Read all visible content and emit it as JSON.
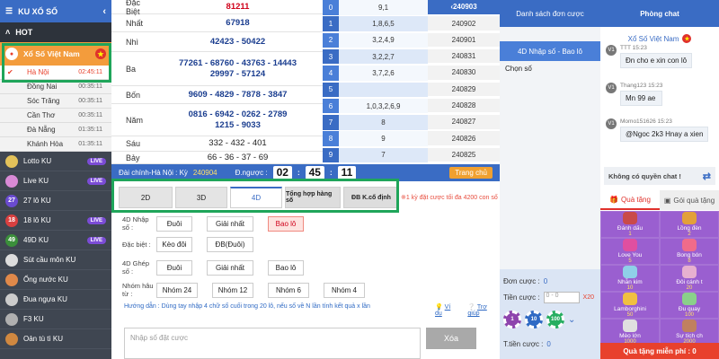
{
  "sidebar": {
    "header": "KU XỔ SỐ",
    "hot": "HOT",
    "xsvn": "Xổ Số Việt Nam",
    "regions": [
      {
        "name": "Hà Nội",
        "time": "02:45:11",
        "selected": true
      },
      {
        "name": "Đồng Nai",
        "time": "00:35:11"
      },
      {
        "name": "Sóc Trăng",
        "time": "00:35:11"
      },
      {
        "name": "Cần Thơ",
        "time": "00:35:11"
      },
      {
        "name": "Đà Nẵng",
        "time": "01:35:11"
      },
      {
        "name": "Khánh Hòa",
        "time": "01:35:11"
      }
    ],
    "games": [
      {
        "label": "Lotto KU",
        "live": "LIVE",
        "icon": "lotto-icon"
      },
      {
        "label": "Live KU",
        "live": "LIVE",
        "icon": "live-dealer-icon"
      },
      {
        "label": "27 lô KU",
        "badge": "27"
      },
      {
        "label": "18 lô KU",
        "live": "LIVE",
        "badge": "18"
      },
      {
        "label": "49D KU",
        "live": "LIVE",
        "badge": "49"
      },
      {
        "label": "Sút cầu môn KU",
        "icon": "soccer-ball-icon"
      },
      {
        "label": "Ống nước KU",
        "icon": "ladder-icon"
      },
      {
        "label": "Đua ngựa KU",
        "icon": "horse-icon"
      },
      {
        "label": "F3 KU",
        "icon": "car-icon"
      },
      {
        "label": "Oản tù tì KU",
        "icon": "hand-icon"
      }
    ]
  },
  "results": {
    "prizes": [
      {
        "name": "Đặc Biệt",
        "nums": "81211",
        "style": "red"
      },
      {
        "name": "Nhất",
        "nums": "67918",
        "style": "blue"
      },
      {
        "name": "Nhì",
        "nums": "42423 - 50422",
        "style": "blue"
      },
      {
        "name": "Ba",
        "nums": "77261 - 68760 - 43763 - 14443\n29997 - 57124",
        "style": "blue"
      },
      {
        "name": "Bốn",
        "nums": "9609 - 4829 - 7878 - 3847",
        "style": "blue"
      },
      {
        "name": "Năm",
        "nums": "0816 - 6942 - 0262 - 2789\n1215 - 9033",
        "style": "blue"
      },
      {
        "name": "Sáu",
        "nums": "332 - 432 - 401",
        "style": ""
      },
      {
        "name": "Bảy",
        "nums": "66 - 36 - 37 - 69",
        "style": ""
      }
    ],
    "digits": [
      {
        "k": "0",
        "v": "9,1"
      },
      {
        "k": "1",
        "v": "1,8,6,5"
      },
      {
        "k": "2",
        "v": "3,2,4,9"
      },
      {
        "k": "3",
        "v": "3,2,2,7"
      },
      {
        "k": "4",
        "v": "3,7,2,6"
      },
      {
        "k": "5",
        "v": ""
      },
      {
        "k": "6",
        "v": "1,0,3,2,6,9"
      },
      {
        "k": "7",
        "v": "8"
      },
      {
        "k": "8",
        "v": "9"
      },
      {
        "k": "9",
        "v": "7"
      }
    ],
    "kys": [
      "240903",
      "240902",
      "240901",
      "240831",
      "240830",
      "240829",
      "240828",
      "240827",
      "240826",
      "240825"
    ]
  },
  "infobar": {
    "label": "Đài chính-Hà Nội : Kỳ",
    "ky": "240904",
    "countdown_label": "Đ.ngược :",
    "h": "02",
    "m": "45",
    "s": "11",
    "home": "Trang chủ"
  },
  "bet": {
    "tabs": [
      "2D",
      "3D",
      "4D",
      "Tổng hợp hàng số",
      "ĐB K.cố định"
    ],
    "note": "1 kỳ đặt cược tối đa 4200 con số",
    "rows": [
      {
        "label": "4D Nhập số :",
        "options": [
          "Đuôi",
          "Giải nhất",
          "Bao lô"
        ]
      },
      {
        "label": "Đặc biệt :",
        "options": [
          "Kèo đôi",
          "ĐB(Đuôi)"
        ]
      },
      {
        "label": "4D Ghép số :",
        "options": [
          "Đuôi",
          "Giải nhất",
          "Bao lô"
        ]
      },
      {
        "label": "Nhóm hâu từ :",
        "options": [
          "Nhóm 24",
          "Nhóm 12",
          "Nhóm 6",
          "Nhóm 4"
        ]
      }
    ],
    "guide": "Hướng dẫn : Dùng tay nhập 4 chữ số cuối trong 20 lô, nếu số về N lần tính kết quả x lần",
    "example": "Ví dụ",
    "help": "Trợ giúp",
    "placeholder": "Nhập số đặt cược",
    "clear": "Xóa"
  },
  "orders": {
    "title": "Danh sách đơn cược",
    "subtitle": "4D Nhập số - Bao lô",
    "choose": "Chọn số",
    "count_label": "Đơn cược :",
    "count": "0",
    "amount_label": "Tiền cược :",
    "amount_placeholder": "0 - 0",
    "multiplier": "X20",
    "chips": [
      "1",
      "10",
      "100"
    ],
    "total_label": "T.tiền cược :",
    "total": "0"
  },
  "chat": {
    "title": "Phòng chat",
    "room": "Xổ Số Việt Nam",
    "messages": [
      {
        "meta": "TTT 15:23",
        "text": "Đn cho e xin con lô",
        "avatar": "V1"
      },
      {
        "meta": "Thang123 15:23",
        "text": "Mn 99 ae",
        "avatar": "V1"
      },
      {
        "meta": "Momo151626 15:23",
        "text": "@Ngoc 2k3 Hnay a xien",
        "avatar": "V1"
      }
    ],
    "no_permission": "Không có quyền chat !",
    "gift_tab": "Quà tặng",
    "gift_pack_tab": "Gói quà tặng",
    "gifts": [
      {
        "name": "Đánh dấu",
        "price": "1"
      },
      {
        "name": "Lồng đèn",
        "price": "2"
      },
      {
        "name": "Love You",
        "price": "5"
      },
      {
        "name": "Bong bón",
        "price": "8"
      },
      {
        "name": "Nhẫn kim",
        "price": "10"
      },
      {
        "name": "Đôi cánh t",
        "price": "20"
      },
      {
        "name": "Lamborghini",
        "price": "50"
      },
      {
        "name": "Đu quay",
        "price": "100"
      },
      {
        "name": "Mèo lớn",
        "price": "1000"
      },
      {
        "name": "Sự tích ch",
        "price": "2000"
      }
    ],
    "free": "Quà tặng miễn phí :",
    "free_count": "0"
  },
  "colors": {
    "primary": "#3a6cc4",
    "accent": "#f39c3c",
    "highlight": "#1fa55a",
    "danger": "#e8412c"
  }
}
